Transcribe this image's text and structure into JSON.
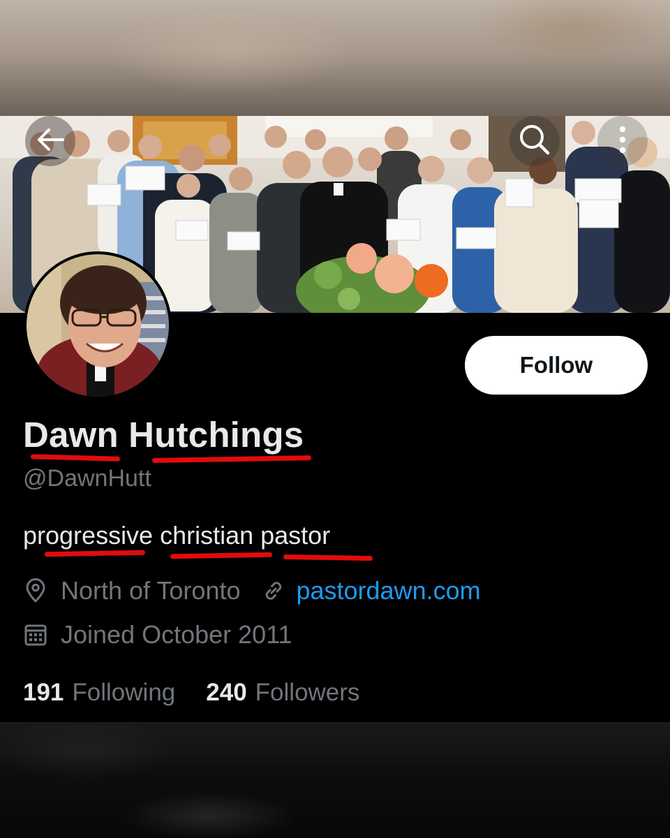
{
  "profile": {
    "display_name": "Dawn Hutchings",
    "handle": "@DawnHutt",
    "bio": "progressive christian pastor",
    "location": "North of Toronto",
    "website": "pastordawn.com",
    "joined": "Joined October 2011"
  },
  "stats": {
    "following_count": "191",
    "following_label": "Following",
    "followers_count": "240",
    "followers_label": "Followers"
  },
  "actions": {
    "follow_label": "Follow"
  },
  "icons": {
    "back": "arrow-left-icon",
    "search": "search-icon",
    "more": "more-vertical-icon",
    "location": "map-pin-icon",
    "link": "link-icon",
    "calendar": "calendar-icon"
  },
  "colors": {
    "background": "#000000",
    "primary_text": "#e7e9ea",
    "secondary_text": "#71767b",
    "link": "#1d9bf0",
    "follow_button_bg": "#ffffff",
    "highlight_underline": "#e10c0c"
  }
}
